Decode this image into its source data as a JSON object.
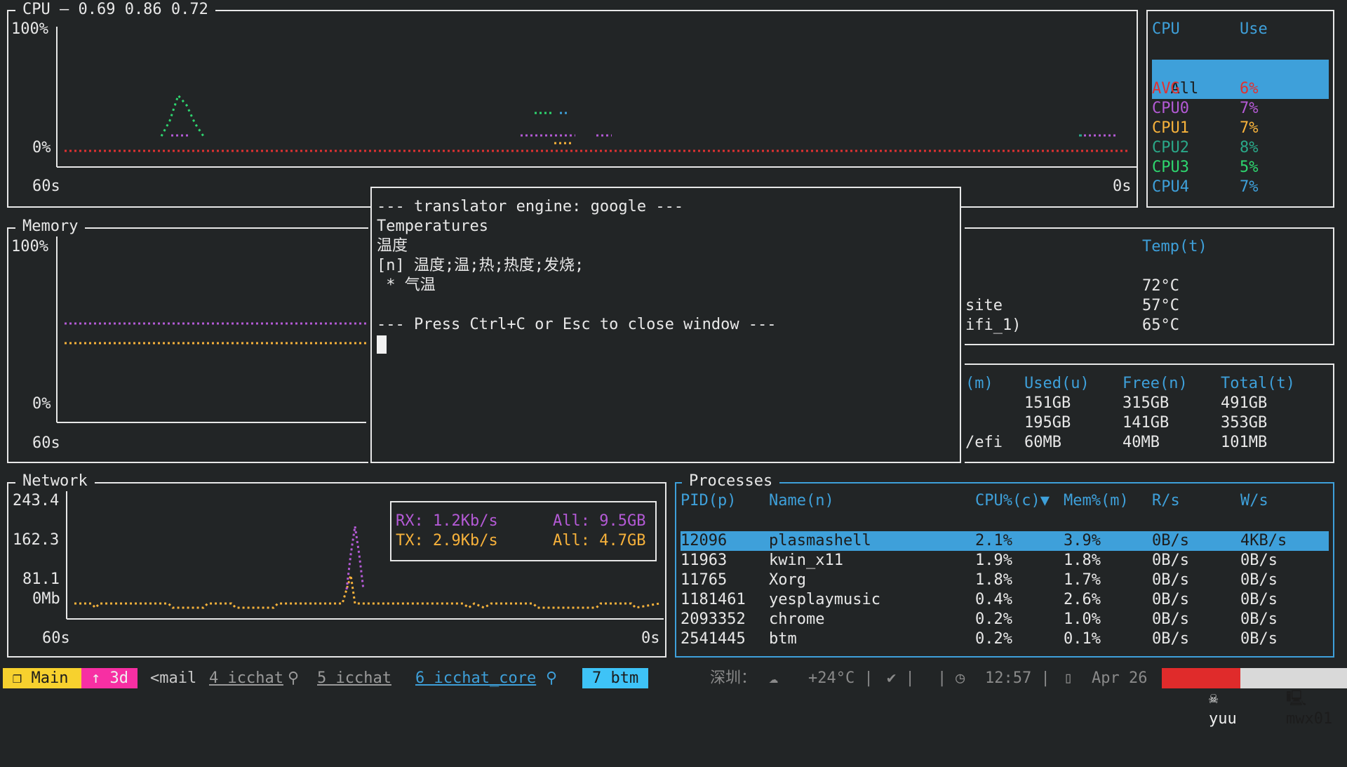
{
  "cpu_panel": {
    "title": "CPU — 0.69 0.86 0.72",
    "y_max": "100%",
    "y_min": "0%",
    "x_left": "60s",
    "x_right": "0s"
  },
  "cpu_legend": {
    "header_cpu": "CPU",
    "header_use": "Use",
    "all_label": "All",
    "rows": [
      {
        "name": "AVG",
        "use": "6%",
        "color": "#e03131"
      },
      {
        "name": "CPU0",
        "use": "7%",
        "color": "#b45ad6"
      },
      {
        "name": "CPU1",
        "use": "7%",
        "color": "#f7b23b"
      },
      {
        "name": "CPU2",
        "use": "8%",
        "color": "#2aa889"
      },
      {
        "name": "CPU3",
        "use": "5%",
        "color": "#2ed66f"
      },
      {
        "name": "CPU4",
        "use": "7%",
        "color": "#3ea0da"
      }
    ]
  },
  "memory_panel": {
    "title": "Memory",
    "y_max": "100%",
    "y_min": "0%",
    "x_left": "60s"
  },
  "translator": {
    "header": "--- translator engine: google ---",
    "word": "Temperatures",
    "translation": "温度",
    "detail": "[n] 温度;温;热;热度;发烧;",
    "sub": " * 气温",
    "footer": "--- Press Ctrl+C or Esc to close window ---"
  },
  "temps": {
    "header": "Temp(t)",
    "rows": [
      {
        "sensor": "",
        "temp": "72°C"
      },
      {
        "sensor": "site",
        "temp": "57°C"
      },
      {
        "sensor": "ifi_1)",
        "temp": "65°C"
      }
    ]
  },
  "disks": {
    "headers": [
      "(m)",
      "Used(u)",
      "Free(n)",
      "Total(t)"
    ],
    "rows": [
      {
        "mount": "",
        "used": "151GB",
        "free": "315GB",
        "total": "491GB"
      },
      {
        "mount": "",
        "used": "195GB",
        "free": "141GB",
        "total": "353GB"
      },
      {
        "mount": "/efi",
        "used": "60MB",
        "free": "40MB",
        "total": "101MB"
      }
    ]
  },
  "network": {
    "title": "Network",
    "y_labels": [
      "243.4",
      "162.3",
      "81.1",
      "0Mb"
    ],
    "x_left": "60s",
    "x_right": "0s",
    "rx_label": "RX: 1.2Kb/s",
    "rx_all": "All: 9.5GB",
    "tx_label": "TX: 2.9Kb/s",
    "tx_all": "All: 4.7GB",
    "rx_color": "#b45ad6",
    "tx_color": "#f7b23b"
  },
  "processes": {
    "title": "Processes",
    "headers": [
      "PID(p)",
      "Name(n)",
      "CPU%(c)▼",
      "Mem%(m)",
      "R/s",
      "W/s"
    ],
    "rows": [
      {
        "pid": "12096",
        "name": "plasmashell",
        "cpu": "2.1%",
        "mem": "3.9%",
        "r": "0B/s",
        "w": "4KB/s"
      },
      {
        "pid": "11963",
        "name": "kwin_x11",
        "cpu": "1.9%",
        "mem": "1.8%",
        "r": "0B/s",
        "w": "0B/s"
      },
      {
        "pid": "11765",
        "name": "Xorg",
        "cpu": "1.8%",
        "mem": "1.7%",
        "r": "0B/s",
        "w": "0B/s"
      },
      {
        "pid": "1181461",
        "name": "yesplaymusic",
        "cpu": "0.4%",
        "mem": "2.6%",
        "r": "0B/s",
        "w": "0B/s"
      },
      {
        "pid": "2093352",
        "name": "chrome",
        "cpu": "0.2%",
        "mem": "1.0%",
        "r": "0B/s",
        "w": "0B/s"
      },
      {
        "pid": "2541445",
        "name": "btm",
        "cpu": "0.2%",
        "mem": "0.1%",
        "r": "0B/s",
        "w": "0B/s"
      }
    ]
  },
  "statusbar": {
    "main": "❐ Main",
    "uptime": "↑ 3d",
    "w_mail": "<mail",
    "w4": "4 icchat",
    "w5": "5 icchat",
    "w6": "6 icchat_core",
    "w7": "7 btm",
    "weather": "深圳：",
    "temp": "+24°C |",
    "check": "✔ |",
    "sep": "|",
    "time": "12:57 |",
    "date": "Apr 26",
    "user": "yuu",
    "host": "mwx01",
    "colors": {
      "main_bg": "#f7d12e",
      "uptime_bg": "#f72fa3",
      "w7_bg": "#3ec3f7",
      "user_bg": "#e02b2b",
      "host_bg": "#d9d9d9"
    }
  }
}
